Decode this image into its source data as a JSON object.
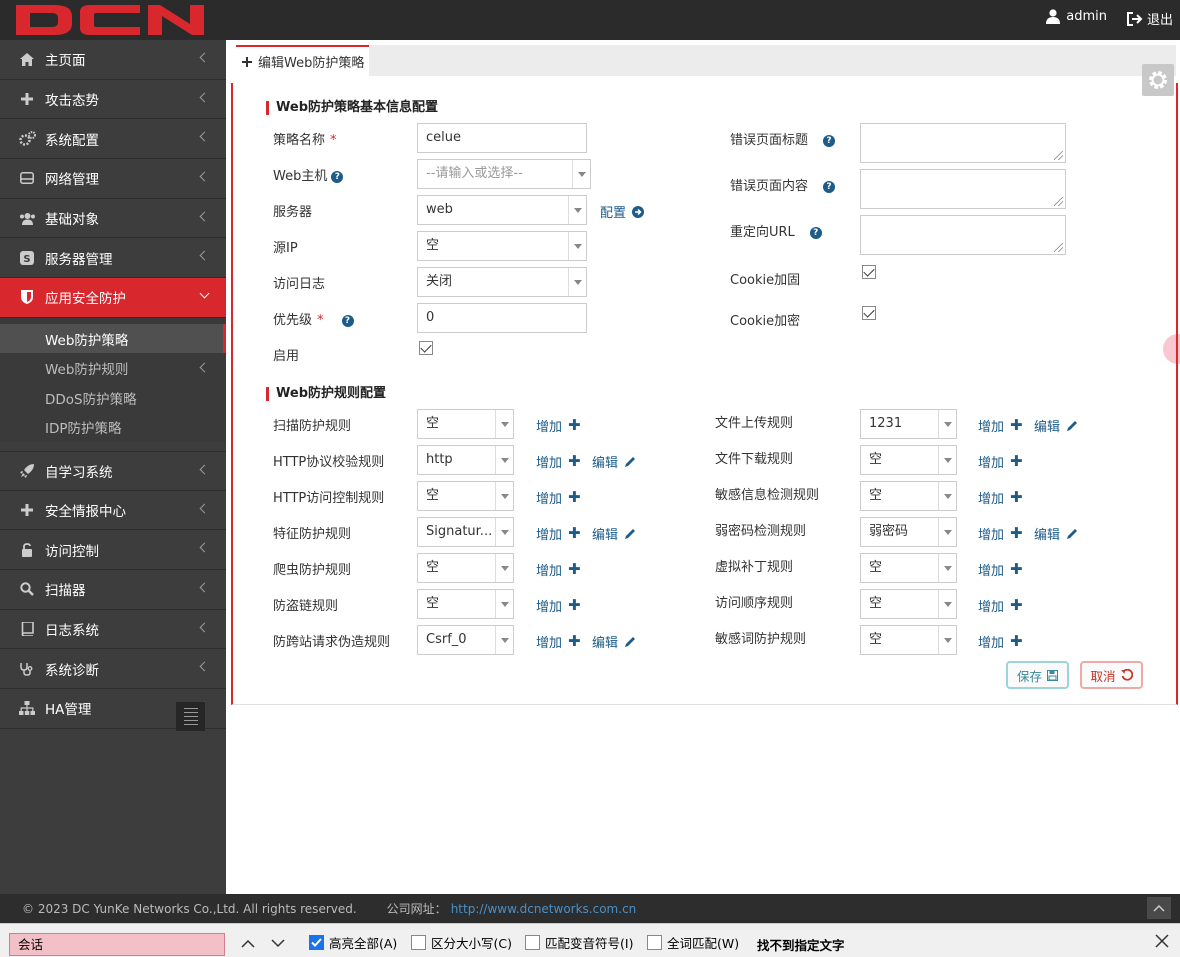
{
  "header": {
    "logo_text": "DCN",
    "user": "admin",
    "logout": "退出",
    "colors": {
      "brand": "#d9272e",
      "topbar": "#2b2b2b"
    }
  },
  "sidebar": {
    "items": [
      {
        "label": "主页面",
        "icon": "home-icon"
      },
      {
        "label": "攻击态势",
        "icon": "plus-icon"
      },
      {
        "label": "系统配置",
        "icon": "cogs-icon"
      },
      {
        "label": "网络管理",
        "icon": "hdd-icon"
      },
      {
        "label": "基础对象",
        "icon": "users-icon"
      },
      {
        "label": "服务器管理",
        "icon": "server-s-icon"
      },
      {
        "label": "应用安全防护",
        "icon": "shield-icon",
        "active": true
      }
    ],
    "subitems": [
      {
        "label": "Web防护策略",
        "current": true
      },
      {
        "label": "Web防护规则"
      },
      {
        "label": "DDoS防护策略"
      },
      {
        "label": "IDP防护策略"
      }
    ],
    "items2": [
      {
        "label": "自学习系统",
        "icon": "rocket-icon"
      },
      {
        "label": "安全情报中心",
        "icon": "plus-icon"
      },
      {
        "label": "访问控制",
        "icon": "unlock-icon"
      },
      {
        "label": "扫描器",
        "icon": "search-icon"
      },
      {
        "label": "日志系统",
        "icon": "book-icon"
      },
      {
        "label": "系统诊断",
        "icon": "stethoscope-icon"
      },
      {
        "label": "HA管理",
        "icon": "sitemap-icon"
      }
    ]
  },
  "tab": {
    "label": "编辑Web防护策略"
  },
  "basic": {
    "title": "Web防护策略基本信息配置",
    "name_label": "策略名称",
    "name_value": "celue",
    "host_label": "Web主机",
    "host_placeholder": "--请输入或选择--",
    "server_label": "服务器",
    "server_value": "web",
    "server_config": "配置",
    "srcip_label": "源IP",
    "srcip_value": "空",
    "log_label": "访问日志",
    "log_value": "关闭",
    "priority_label": "优先级",
    "priority_value": "0",
    "enable_label": "启用",
    "enable_checked": true,
    "err_title_label": "错误页面标题",
    "err_content_label": "错误页面内容",
    "redirect_label": "重定向URL",
    "cookie_harden_label": "Cookie加固",
    "cookie_harden_checked": true,
    "cookie_encrypt_label": "Cookie加密",
    "cookie_encrypt_checked": true
  },
  "rules": {
    "title": "Web防护规则配置",
    "add": "增加",
    "edit": "编辑",
    "left": [
      {
        "label": "扫描防护规则",
        "value": "空",
        "edit": false
      },
      {
        "label": "HTTP协议校验规则",
        "value": "http",
        "edit": true
      },
      {
        "label": "HTTP访问控制规则",
        "value": "空",
        "edit": false
      },
      {
        "label": "特征防护规则",
        "value": "Signatur...",
        "edit": true
      },
      {
        "label": "爬虫防护规则",
        "value": "空",
        "edit": false
      },
      {
        "label": "防盗链规则",
        "value": "空",
        "edit": false
      },
      {
        "label": "防跨站请求伪造规则",
        "value": "Csrf_0",
        "edit": true
      }
    ],
    "right": [
      {
        "label": "文件上传规则",
        "value": "1231",
        "edit": true
      },
      {
        "label": "文件下载规则",
        "value": "空",
        "edit": false
      },
      {
        "label": "敏感信息检测规则",
        "value": "空",
        "edit": false
      },
      {
        "label": "弱密码检测规则",
        "value": "弱密码",
        "edit": true
      },
      {
        "label": "虚拟补丁规则",
        "value": "空",
        "edit": false
      },
      {
        "label": "访问顺序规则",
        "value": "空",
        "edit": false
      },
      {
        "label": "敏感词防护规则",
        "value": "空",
        "edit": false
      }
    ]
  },
  "buttons": {
    "save": "保存",
    "cancel": "取消"
  },
  "footer": {
    "copyright": "© 2023 DC YunKe Networks Co.,Ltd. All rights reserved.",
    "site_label": "公司网址：",
    "site_url": "http://www.dcnetworks.com.cn"
  },
  "findbar": {
    "query": "会话",
    "highlight_all": "高亮全部(A)",
    "highlight_all_checked": true,
    "match_case": "区分大小写(C)",
    "match_diacritics": "匹配变音符号(I)",
    "whole_words": "全词匹配(W)",
    "status": "找不到指定文字"
  }
}
